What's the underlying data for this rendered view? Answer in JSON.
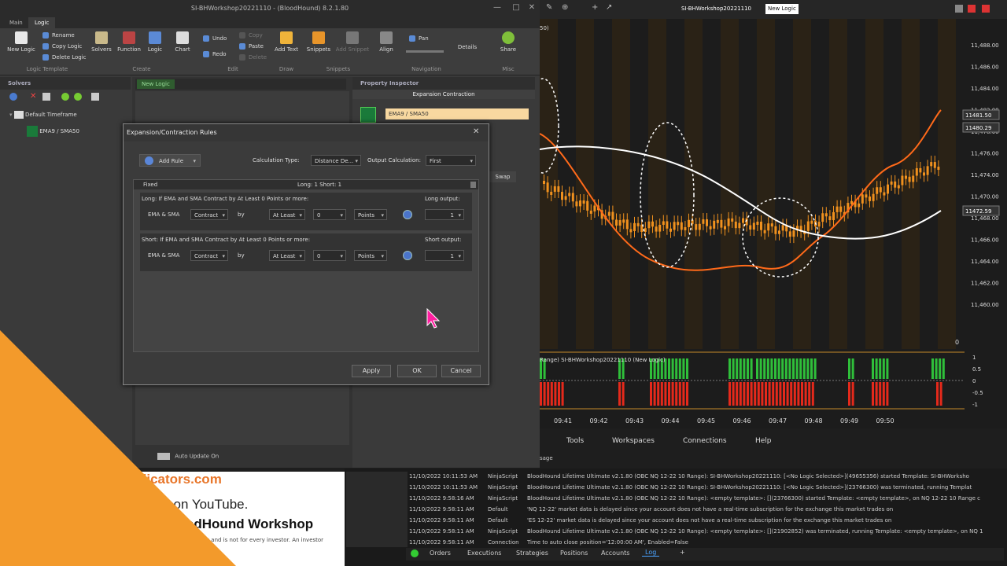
{
  "window": {
    "title": "SI-BHWorkshop20221110 - (BloodHound) 8.2.1.80"
  },
  "ribbon": {
    "tabs": [
      "Main",
      "Logic"
    ],
    "logic_template": {
      "new_logic": "New Logic",
      "rename": "Rename",
      "copy_logic": "Copy Logic",
      "delete_logic": "Delete Logic",
      "group": "Logic Template"
    },
    "create": {
      "solvers": "Solvers",
      "function": "Function",
      "logic": "Logic",
      "chart": "Chart",
      "group": "Create"
    },
    "edit": {
      "undo": "Undo",
      "redo": "Redo",
      "copy": "Copy",
      "paste": "Paste",
      "delete": "Delete",
      "group": "Edit"
    },
    "draw": {
      "add_text": "Add Text",
      "group": "Draw"
    },
    "snippets": {
      "snippets": "Snippets",
      "add_snippet": "Add Snippet",
      "group": "Snippets"
    },
    "align": {
      "align": "Align"
    },
    "navigation": {
      "pan": "Pan",
      "details": "Details",
      "group": "Navigation"
    },
    "misc": {
      "share": "Share",
      "group": "Misc"
    }
  },
  "solvers": {
    "header": "Solvers",
    "tree_root": "Default Timeframe",
    "tree_child": "EMA9 / SMA50"
  },
  "canvas": {
    "tab": "New Logic",
    "auto_update": "Auto Update On"
  },
  "property_inspector": {
    "header": "Property Inspector",
    "title": "Expansion Contraction",
    "name_value": "EMA9 / SMA50",
    "swap": "Swap"
  },
  "dialog": {
    "title": "Expansion/Contraction Rules",
    "add_rule": "Add Rule",
    "calc_type_label": "Calculation Type:",
    "calc_type_value": "Distance De...",
    "output_calc_label": "Output Calculation:",
    "output_calc_value": "First",
    "header_fixed": "Fixed",
    "header_summary": "Long: 1 Short: 1",
    "long_rule": {
      "desc": "Long: If EMA and SMA Contract by At Least 0 Points or more:",
      "subject": "EMA & SMA",
      "mode": "Contract",
      "by": "by",
      "cmp": "At Least",
      "amount": "0",
      "unit": "Points",
      "output_label": "Long output:",
      "output": "1"
    },
    "short_rule": {
      "desc": "Short: If EMA and SMA Contract by At Least 0 Points or more:",
      "subject": "EMA & SMA",
      "mode": "Contract",
      "by": "by",
      "cmp": "At Least",
      "amount": "0",
      "unit": "Points",
      "output_label": "Short output:",
      "output": "1"
    },
    "apply": "Apply",
    "ok": "OK",
    "cancel": "Cancel"
  },
  "chart": {
    "title": "SI-BHWorkshop20221110",
    "logic_tag": "New Logic",
    "price_labels": [
      "11,488.00",
      "11,486.00",
      "11,484.00",
      "11,482.00",
      "11,478.00",
      "11,476.00",
      "11,474.00",
      "11,470.00",
      "11,468.00",
      "11,466.00",
      "11,464.00",
      "11,462.00",
      "11,460.00"
    ],
    "highlight_prices": [
      "11481.50",
      "11480.29",
      "11472.59"
    ],
    "zero_label": "0",
    "subpanel_label": "Range) SI-BHWorkshop20221110 (New Logic)",
    "sub_axis": [
      "1",
      "0.5",
      "0",
      "-0.5",
      "-1"
    ],
    "time_labels": [
      "09:41",
      "09:42",
      "09:43",
      "09:44",
      "09:45",
      "09:46",
      "09:47",
      "09:48",
      "09:49",
      "09:50"
    ],
    "corner_label": "50)"
  },
  "menu": {
    "tools": "Tools",
    "workspaces": "Workspaces",
    "connections": "Connections",
    "help": "Help"
  },
  "log": {
    "header": "sage",
    "rows": [
      {
        "time": "11/10/2022 10:11:53 AM",
        "cat": "NinjaScript",
        "msg": "BloodHound Lifetime Ultimate v2.1.80 (OBC NQ 12-22 10 Range): SI-BHWorkshop20221110: [<No Logic Selected>](49655356) started Template: SI-BHWorksho"
      },
      {
        "time": "11/10/2022 10:11:53 AM",
        "cat": "NinjaScript",
        "msg": "BloodHound Lifetime Ultimate v2.1.80 (OBC NQ 12-22 10 Range): SI-BHWorkshop20221110: [<No Logic Selected>](23766300) was terminated, running Templat"
      },
      {
        "time": "11/10/2022 9:58:16 AM",
        "cat": "NinjaScript",
        "msg": "BloodHound Lifetime Ultimate v2.1.80 (OBC NQ 12-22 10 Range): <empty template>: [](23766300) started Template: <empty template>, on NQ 12-22 10 Range c"
      },
      {
        "time": "11/10/2022 9:58:11 AM",
        "cat": "Default",
        "msg": "'NQ 12-22' market data is delayed since your account does not have a real-time subscription for the exchange this market trades on"
      },
      {
        "time": "11/10/2022 9:58:11 AM",
        "cat": "Default",
        "msg": "'ES 12-22' market data is delayed since your account does not have a real-time subscription for the exchange this market trades on"
      },
      {
        "time": "11/10/2022 9:58:11 AM",
        "cat": "NinjaScript",
        "msg": "BloodHound Lifetime Ultimate v2.1.80 (OBC NQ 12-22 10 Range): <empty template>: [](21902852) was terminated, running Template: <empty template>, on NQ 1"
      },
      {
        "time": "11/10/2022 9:58:11 AM",
        "cat": "Connection",
        "msg": "Time to auto close position='12:00:00 AM', Enabled=False"
      }
    ]
  },
  "bottom_tabs": [
    "Orders",
    "Executions",
    "Strategies",
    "Positions",
    "Accounts",
    "Log",
    "+"
  ],
  "promo": {
    "line1": "dicators.com",
    "line2": "l on YouTube.",
    "line3": "odHound Workshop",
    "line4": "k and is not for every investor. An investor"
  },
  "colors": {
    "accent_orange": "#f39a2b",
    "bull_candle": "#f0911e",
    "ema_line": "#ff6a1a",
    "sma_line": "#ffffff",
    "signal_green": "#2fbf3a",
    "signal_red": "#e5291b"
  }
}
